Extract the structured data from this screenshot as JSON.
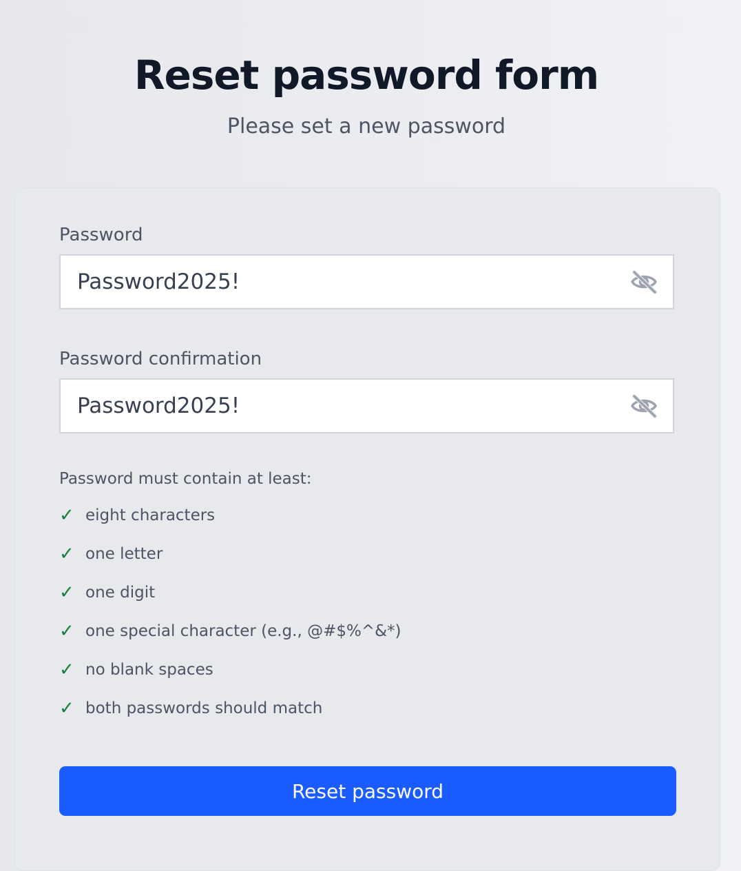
{
  "header": {
    "title": "Reset password form",
    "subtitle": "Please set a new password"
  },
  "form": {
    "password": {
      "label": "Password",
      "value": "Password2025!",
      "toggle_icon": "eye-slash-icon"
    },
    "confirmation": {
      "label": "Password confirmation",
      "value": "Password2025!",
      "toggle_icon": "eye-slash-icon"
    },
    "requirements": {
      "title": "Password must contain at least:",
      "check_icon": "check-icon",
      "check_color": "#15803d",
      "items": [
        {
          "text": "eight characters",
          "met": true
        },
        {
          "text": "one letter",
          "met": true
        },
        {
          "text": "one digit",
          "met": true
        },
        {
          "text": "one special character (e.g., @#$%^&*)",
          "met": true
        },
        {
          "text": "no blank spaces",
          "met": true
        },
        {
          "text": "both passwords should match",
          "met": true
        }
      ]
    },
    "submit_label": "Reset password",
    "accent_color": "#1a5cff"
  }
}
